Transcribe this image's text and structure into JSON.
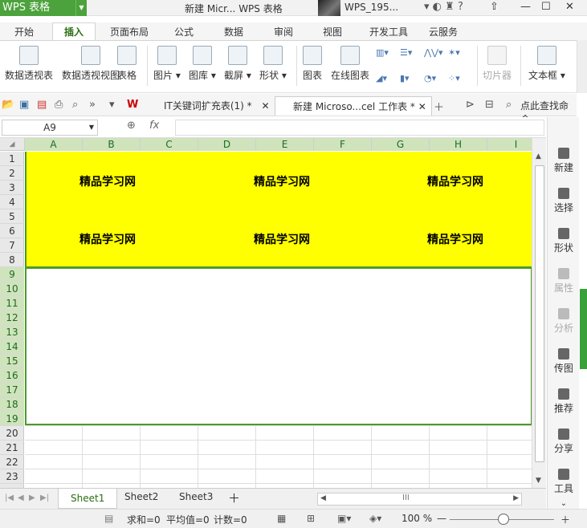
{
  "app": {
    "logo": "WPS 表格",
    "doc_title": "新建 Micr... WPS 表格",
    "user": "WPS_195..."
  },
  "window": {
    "minimize": "—",
    "maximize": "☐",
    "close": "✕"
  },
  "menu_tabs": [
    "开始",
    "插入",
    "页面布局",
    "公式",
    "数据",
    "审阅",
    "视图",
    "开发工具",
    "云服务"
  ],
  "active_tab": "插入",
  "ribbon": {
    "buttons": [
      "数据透视表",
      "数据透视视图",
      "表格",
      "图片",
      "图库",
      "截屏",
      "形状",
      "图表",
      "在线图表",
      "切片器",
      "文本框"
    ]
  },
  "quickbar": {
    "doc_tabs": [
      "IT关键词扩充表(1) *",
      "新建 Microso...cel 工作表 *"
    ],
    "search": "点此查找命令"
  },
  "formula": {
    "cell": "A9",
    "fx": "fx",
    "value": ""
  },
  "columns": [
    "A",
    "B",
    "C",
    "D",
    "E",
    "F",
    "G",
    "H",
    "I"
  ],
  "rows": [
    "1",
    "2",
    "3",
    "4",
    "5",
    "6",
    "7",
    "8",
    "9",
    "10",
    "11",
    "12",
    "13",
    "14",
    "15",
    "16",
    "17",
    "18",
    "19",
    "20",
    "21",
    "22",
    "23"
  ],
  "cells": {
    "text": "精品学习网"
  },
  "right_panel": [
    "新建",
    "选择",
    "形状",
    "属性",
    "分析",
    "传图",
    "推荐",
    "分享",
    "工具"
  ],
  "sheets": [
    "Sheet1",
    "Sheet2",
    "Sheet3"
  ],
  "status": {
    "sum": "求和=0",
    "avg": "平均值=0",
    "count": "计数=0",
    "zoom": "100 %"
  },
  "colors": {
    "fill": "#ffff00",
    "accent": "#4ca23c"
  }
}
